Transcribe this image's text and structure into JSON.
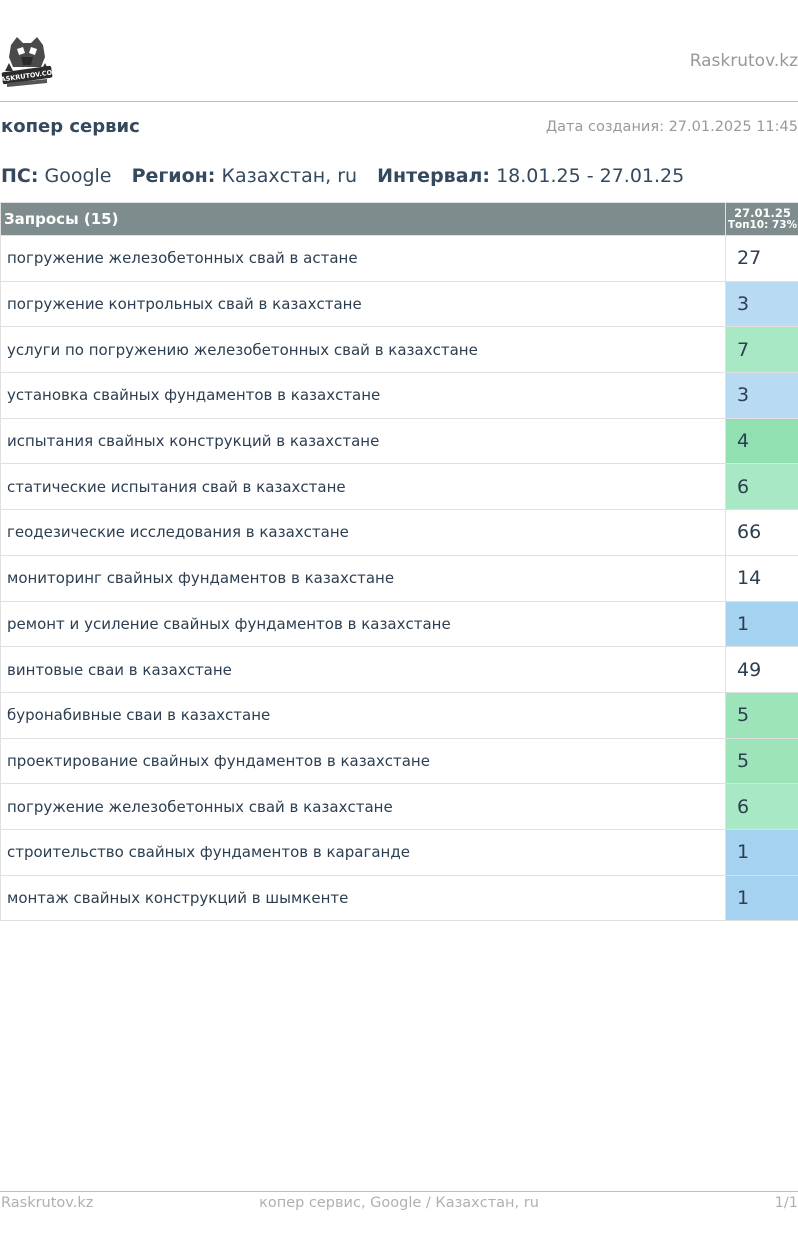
{
  "header": {
    "logo_text": "RASKRUTOV.COM",
    "site_name": "Raskrutov.kz"
  },
  "report": {
    "title": "копер сервис",
    "created_label": "Дата создания:",
    "created_value": "27.01.2025 11:45"
  },
  "meta": {
    "engine_label": "ПС:",
    "engine_value": "Google",
    "region_label": "Регион:",
    "region_value": "Казахстан, ru",
    "interval_label": "Интервал:",
    "interval_value": "18.01.25 - 27.01.25"
  },
  "table": {
    "queries_header": "Запросы (15)",
    "date_header": "27.01.25",
    "top_header": "Топ10: 73%",
    "rows": [
      {
        "query": "погружение железобетонных свай в астане",
        "position": "27",
        "color": "#ffffff"
      },
      {
        "query": "погружение контрольных свай в казахстане",
        "position": "3",
        "color": "#b8daf3"
      },
      {
        "query": "услуги по погружению железобетонных свай в казахстане",
        "position": "7",
        "color": "#a9e8c4"
      },
      {
        "query": "установка свайных фундаментов в казахстане",
        "position": "3",
        "color": "#b8daf3"
      },
      {
        "query": "испытания свайных конструкций в казахстане",
        "position": "4",
        "color": "#90e0b2"
      },
      {
        "query": "статические испытания свай в казахстане",
        "position": "6",
        "color": "#a9e8c4"
      },
      {
        "query": "геодезические исследования в казахстане",
        "position": "66",
        "color": "#ffffff"
      },
      {
        "query": "мониторинг свайных фундаментов в казахстане",
        "position": "14",
        "color": "#ffffff"
      },
      {
        "query": "ремонт и усиление свайных фундаментов в казахстане",
        "position": "1",
        "color": "#a4d2f0"
      },
      {
        "query": "винтовые сваи в казахстане",
        "position": "49",
        "color": "#ffffff"
      },
      {
        "query": "буронабивные сваи в казахстане",
        "position": "5",
        "color": "#9ee4bb"
      },
      {
        "query": "проектирование свайных фундаментов в казахстане",
        "position": "5",
        "color": "#9ee4bb"
      },
      {
        "query": "погружение железобетонных свай в казахстане",
        "position": "6",
        "color": "#a9e8c4"
      },
      {
        "query": "строительство свайных фундаментов в караганде",
        "position": "1",
        "color": "#a4d2f0"
      },
      {
        "query": "монтаж свайных конструкций в шымкенте",
        "position": "1",
        "color": "#a4d2f0"
      }
    ]
  },
  "footer": {
    "left": "Raskrutov.kz",
    "center": "копер сервис, Google / Казахстан, ru",
    "right": "1/1"
  }
}
